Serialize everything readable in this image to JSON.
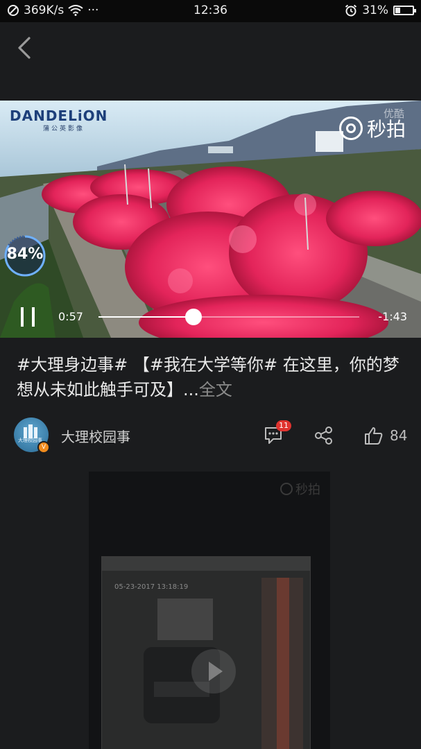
{
  "status_bar": {
    "network_speed": "369K/s",
    "dots": "···",
    "time": "12:36",
    "battery": "31%",
    "battery_level": 0.31
  },
  "video": {
    "brand": "DANDELiON",
    "brand_sub": "蒲公英影像",
    "watermark_faint": "优酷",
    "watermark": "秒拍",
    "buffer_progress": "84%",
    "buffer_fraction": 0.84,
    "current_time": "0:57",
    "remaining_time": "-1:43",
    "played_fraction": 0.364
  },
  "post": {
    "caption": "#大理身边事# 【#我在大学等你# 在这里，你的梦想从未如此触手可及】...",
    "more_label": "全文",
    "author": "大理校园事",
    "avatar_tag": "大理校园事",
    "avatar_badge": "V",
    "comment_count": "11",
    "like_count": "84"
  },
  "next_video": {
    "watermark": "秒拍",
    "timestamp": "05-23-2017 13:18:19"
  },
  "colors": {
    "background": "#1b1c1e",
    "badge_red": "#e0332f",
    "verified_orange": "#f08b1d"
  },
  "icons": [
    "back-icon",
    "wifi-icon",
    "alarm-icon",
    "battery-icon",
    "pause-icon",
    "comment-icon",
    "share-icon",
    "like-icon",
    "play-icon"
  ]
}
